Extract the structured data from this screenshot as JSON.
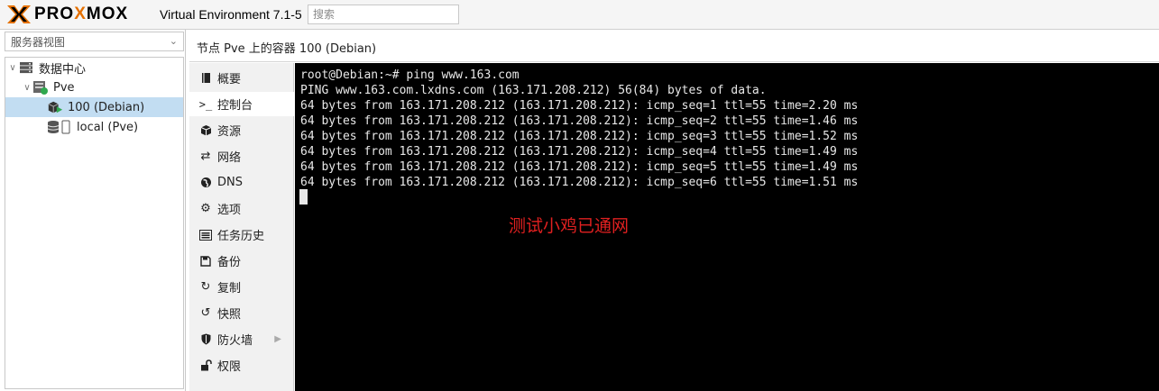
{
  "topbar": {
    "logo_prefix": "PRO",
    "logo_mid": "X",
    "logo_suffix": "MOX",
    "version": "Virtual Environment 7.1-5",
    "search_placeholder": "搜索"
  },
  "tree": {
    "view_select": "服务器视图",
    "items": [
      {
        "label": "数据中心",
        "icon": "datacenter-icon"
      },
      {
        "label": "Pve",
        "icon": "node-icon"
      },
      {
        "label": "100 (Debian)",
        "icon": "container-icon",
        "selected": true
      },
      {
        "label": "local (Pve)",
        "icon": "storage-icon"
      }
    ]
  },
  "header": {
    "breadcrumb": "节点 Pve 上的容器 100 (Debian)"
  },
  "menu": {
    "items": [
      {
        "label": "概要",
        "icon": "summary-icon"
      },
      {
        "label": "控制台",
        "icon": "console-icon",
        "active": true
      },
      {
        "label": "资源",
        "icon": "resources-icon"
      },
      {
        "label": "网络",
        "icon": "network-icon"
      },
      {
        "label": "DNS",
        "icon": "dns-icon"
      },
      {
        "label": "选项",
        "icon": "options-icon"
      },
      {
        "label": "任务历史",
        "icon": "task-history-icon"
      },
      {
        "label": "备份",
        "icon": "backup-icon"
      },
      {
        "label": "复制",
        "icon": "replication-icon"
      },
      {
        "label": "快照",
        "icon": "snapshot-icon"
      },
      {
        "label": "防火墙",
        "icon": "firewall-icon"
      },
      {
        "label": "权限",
        "icon": "permissions-icon"
      }
    ]
  },
  "console": {
    "lines": [
      "root@Debian:~# ping www.163.com",
      "PING www.163.com.lxdns.com (163.171.208.212) 56(84) bytes of data.",
      "64 bytes from 163.171.208.212 (163.171.208.212): icmp_seq=1 ttl=55 time=2.20 ms",
      "64 bytes from 163.171.208.212 (163.171.208.212): icmp_seq=2 ttl=55 time=1.46 ms",
      "64 bytes from 163.171.208.212 (163.171.208.212): icmp_seq=3 ttl=55 time=1.52 ms",
      "64 bytes from 163.171.208.212 (163.171.208.212): icmp_seq=4 ttl=55 time=1.49 ms",
      "64 bytes from 163.171.208.212 (163.171.208.212): icmp_seq=5 ttl=55 time=1.49 ms",
      "64 bytes from 163.171.208.212 (163.171.208.212): icmp_seq=6 ttl=55 time=1.51 ms"
    ],
    "annotation": "测试小鸡已通网",
    "annotation_color": "#e02020"
  },
  "colors": {
    "brand_orange": "#e57000",
    "selection": "#c2ddf2",
    "console_bg": "#000000"
  }
}
